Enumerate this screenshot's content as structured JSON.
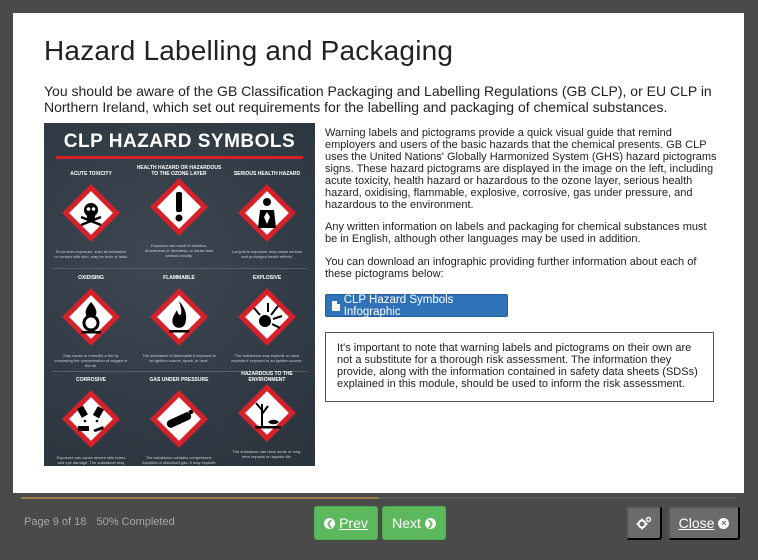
{
  "page": {
    "title": "Hazard Labelling and Packaging",
    "intro": "You should be aware of the GB Classification Packaging and Labelling Regulations (GB CLP), or EU CLP in Northern Ireland, which set out requirements for the labelling and packaging of chemical substances."
  },
  "poster": {
    "title": "CLP HAZARD SYMBOLS",
    "cells": [
      {
        "label": "ACUTE TOXICITY",
        "icon": "skull-crossbones-icon",
        "desc": "Short-term exposure, such as inhalation or contact with skin, may be toxic or fatal."
      },
      {
        "label": "HEALTH HAZARD OR HAZARDOUS TO THE OZONE LAYER",
        "icon": "exclamation-mark-icon",
        "desc": "Exposure can result in irritation, drowsiness or dizziness, or cause less serious toxicity."
      },
      {
        "label": "SERIOUS HEALTH HAZARD",
        "icon": "health-hazard-icon",
        "desc": "Long-term exposure may cause serious and prolonged health effects."
      },
      {
        "label": "OXIDISING",
        "icon": "flame-over-circle-icon",
        "desc": "May cause or intensify a fire by increasing the concentration of oxygen in the air."
      },
      {
        "label": "FLAMMABLE",
        "icon": "flame-icon",
        "desc": "The substance is flammable if exposed to an ignition source, spark, or heat."
      },
      {
        "label": "EXPLOSIVE",
        "icon": "exploding-bomb-icon",
        "desc": "The substance may explode or must explode if exposed to an ignition source."
      },
      {
        "label": "CORROSIVE",
        "icon": "corrosion-icon",
        "desc": "Exposure can cause severe skin burns and eye damage. The substance may also be corrosive to metals."
      },
      {
        "label": "GAS UNDER PRESSURE",
        "icon": "gas-cylinder-icon",
        "desc": "The substance contains compressed, liquefied or dissolved gas. It may explode if heated."
      },
      {
        "label": "HAZARDOUS TO THE ENVIRONMENT",
        "icon": "environment-icon",
        "desc": "The substance can have acute or long-term impacts on aquatic life."
      }
    ]
  },
  "body": {
    "para1": "Warning labels and pictograms provide a quick visual guide that remind employers and users of the basic hazards that the chemical presents. GB CLP uses the United Nations' Globally Harmonized System (GHS) hazard pictograms signs. These hazard pictograms are displayed in the image on the left, including acute toxicity, health hazard or hazardous to the ozone layer, serious health hazard, oxidising, flammable, explosive, corrosive, gas under pressure, and hazardous to the environment.",
    "para2": "Any written information on labels and packaging for chemical substances must be in English, although other languages may be used in addition.",
    "para3": "You can download an infographic providing further information about each of these pictograms below:",
    "download_label": "CLP Hazard Symbols Infographic",
    "note": "It's important to note that warning labels and pictograms on their own are not a substitute for a thorough risk assessment. The information they provide, along with the information contained in safety data sheets (SDSs) explained in this module, should be used to inform the risk assessment."
  },
  "footer": {
    "page_label": "Page 9 of 18",
    "completed_label": "50% Completed",
    "progress": 0.5,
    "prev_label": "Prev",
    "next_label": "Next",
    "close_label": "Close"
  },
  "colors": {
    "accent_green": "#5cb85c",
    "link_blue": "#2f72b8",
    "hazard_red": "#d6202a"
  }
}
